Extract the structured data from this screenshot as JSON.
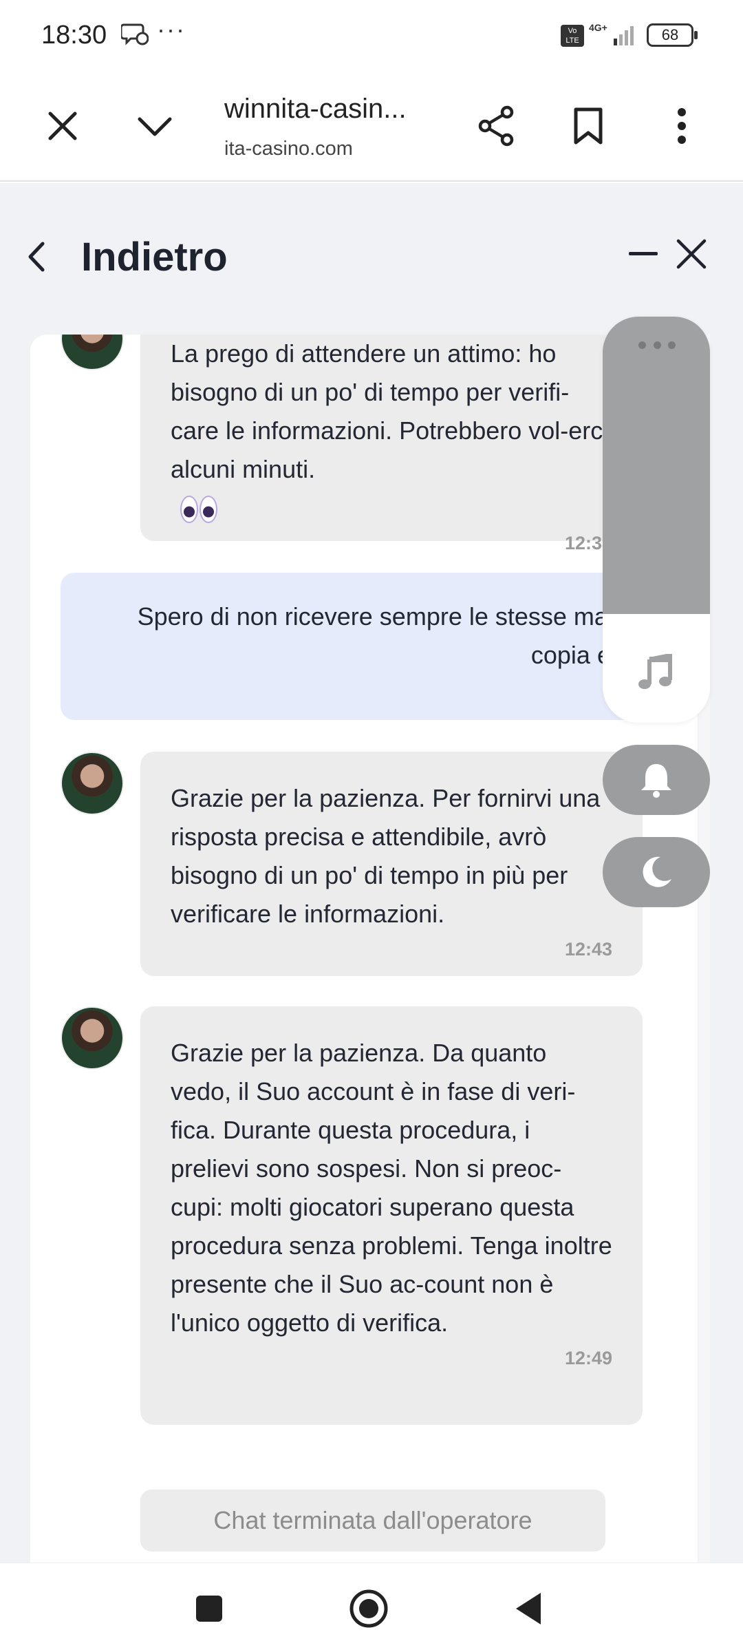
{
  "status_bar": {
    "time": "18:30",
    "more": "···",
    "volte": "Vo LTE",
    "network": "4G+",
    "battery": "68",
    "icons": [
      "chat-notification-icon",
      "signal-icon",
      "battery-icon"
    ]
  },
  "browser": {
    "title": "winnita-casin...",
    "url": "ita-casino.com",
    "icons": [
      "close-icon",
      "chevron-down-icon",
      "share-icon",
      "bookmark-icon",
      "more-vert-icon"
    ]
  },
  "chat": {
    "back_label": "Indietro",
    "messages": [
      {
        "sender": "operator",
        "text": "La prego di attendere un attimo: ho bisogno di un po' di tempo per verifi-care le informazioni. Potrebbero vol-erci alcuni minuti.",
        "time": "12:38"
      },
      {
        "sender": "user",
        "text": "Spero di non ricevere sempre le stesse mande copia e inc"
      },
      {
        "sender": "operator",
        "text": "Grazie per la pazienza. Per fornirvi una risposta precisa e attendibile, avrò bisogno di un po' di tempo in più per verificare le informazioni.",
        "time": "12:43"
      },
      {
        "sender": "operator",
        "text": "Grazie per la pazienza. Da quanto vedo, il Suo account è in fase di veri-fica. Durante questa procedura, i prelievi sono sospesi. Non si preoc-cupi: molti giocatori superano questa procedura senza problemi. Tenga inoltre presente che il Suo ac-count non è l'unico oggetto di verifica.",
        "time": "12:49"
      }
    ],
    "ended_label": "Chat terminata dall'operatore"
  },
  "widget": {
    "icons": [
      "more-dots-icon",
      "music-note-icon",
      "bell-icon",
      "moon-icon"
    ]
  },
  "nav": {
    "icons": [
      "recents-square-icon",
      "home-circle-icon",
      "back-triangle-icon"
    ]
  }
}
